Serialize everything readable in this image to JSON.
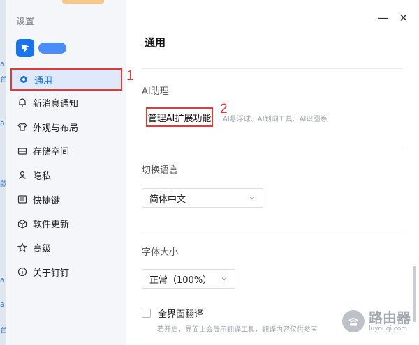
{
  "background": {
    "fragments": [
      "a",
      "台",
      "a",
      "款",
      "a",
      "a",
      "台"
    ]
  },
  "sidebar": {
    "title": "设置",
    "items": [
      {
        "label": "通用",
        "icon": "settings-dot-icon",
        "active": true
      },
      {
        "label": "新消息通知",
        "icon": "bell-icon"
      },
      {
        "label": "外观与布局",
        "icon": "shirt-icon"
      },
      {
        "label": "存储空间",
        "icon": "storage-icon"
      },
      {
        "label": "隐私",
        "icon": "person-icon"
      },
      {
        "label": "快捷键",
        "icon": "keyboard-icon"
      },
      {
        "label": "软件更新",
        "icon": "cube-icon"
      },
      {
        "label": "高级",
        "icon": "star-icon"
      },
      {
        "label": "关于钉钉",
        "icon": "info-icon"
      }
    ]
  },
  "annotations": {
    "one": "1",
    "two": "2"
  },
  "window": {
    "minimize": "—",
    "close": "✕"
  },
  "main": {
    "title": "通用",
    "ai": {
      "label": "AI助理",
      "button": "管理AI扩展功能",
      "desc": "AI悬浮球、AI划词工具、AI识图等"
    },
    "language": {
      "label": "切换语言",
      "value": "简体中文"
    },
    "font": {
      "label": "字体大小",
      "value": "正常（100%）"
    },
    "translate": {
      "label": "全界面翻译",
      "desc": "若开启，界面上会展示翻译工具，翻译内容仅供参考"
    }
  },
  "watermark": {
    "cn": "路由器",
    "en": "luyouqi.com"
  },
  "colors": {
    "accent": "#1a73e8",
    "highlight": "#e53935"
  }
}
